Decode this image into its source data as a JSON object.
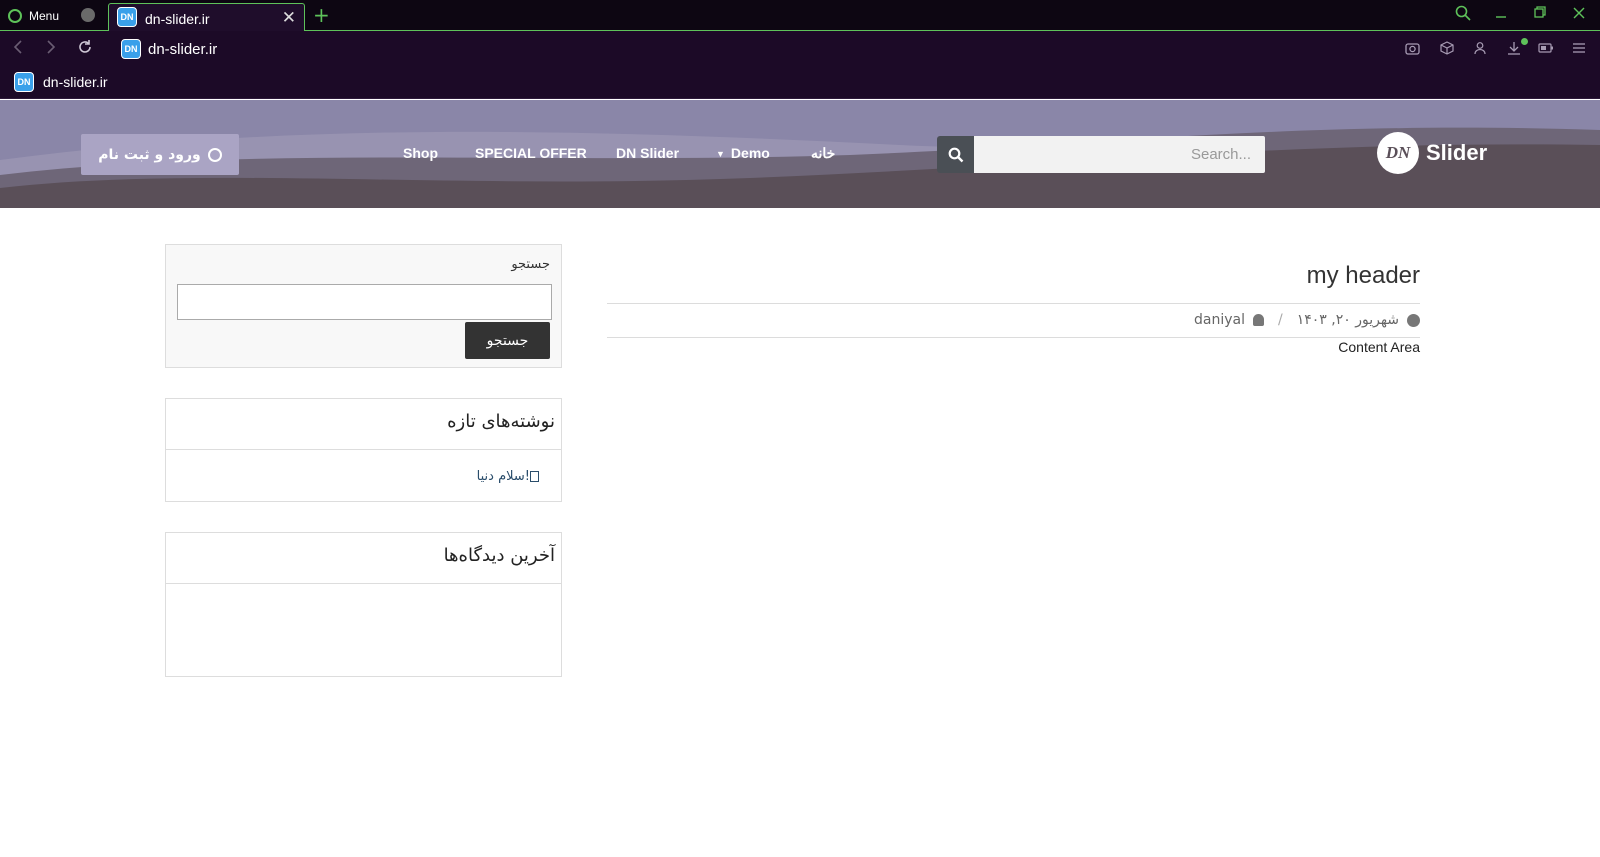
{
  "browser": {
    "menu_label": "Menu",
    "tab_title": "dn-slider.ir",
    "favicon_text": "DN",
    "new_tab": "+",
    "close_glyph": "✕",
    "address": "dn-slider.ir",
    "bookmark": "dn-slider.ir",
    "accent_color": "#5ec25a"
  },
  "header": {
    "logo_mark": "DN",
    "logo_text": "Slider",
    "search_placeholder": "Search...",
    "search_icon": "search-icon",
    "menu": [
      {
        "label": "خانه"
      },
      {
        "label": "Demo",
        "has_dropdown": true
      },
      {
        "label": "DN Slider"
      },
      {
        "label": "SPECIAL OFFER"
      },
      {
        "label": "Shop"
      }
    ],
    "login_label": "ورود و ثبت نام",
    "colors": {
      "sky": "#8a86a8",
      "hill_dark": "#5a4f58",
      "hill_mid": "#6e6678"
    }
  },
  "post": {
    "title": "my header",
    "date": "شهریور ۲۰, ۱۴۰۳",
    "author": "daniyal",
    "separator": "/",
    "content": "Content Area"
  },
  "sidebar": {
    "search_label": "جستجو",
    "search_button": "جستجو",
    "recent_title": "نوشته‌های تازه",
    "recent_items": [
      "سلام دنیا!"
    ],
    "comments_title": "آخرین دیدگاه‌ها"
  }
}
